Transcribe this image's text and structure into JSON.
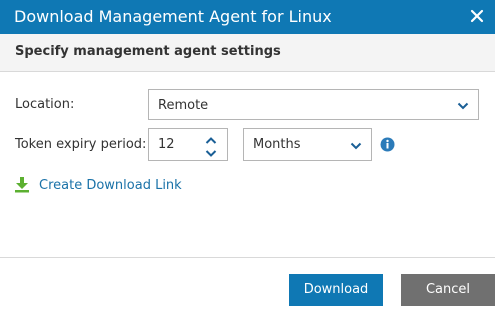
{
  "dialog": {
    "title": "Download Management Agent for Linux",
    "section_title": "Specify management agent settings",
    "close_icon": "close-icon"
  },
  "form": {
    "location": {
      "label": "Location:",
      "value": "Remote"
    },
    "token_expiry": {
      "label": "Token expiry period:",
      "amount": "12",
      "unit": "Months"
    },
    "info_icon": "info-icon"
  },
  "download_link": {
    "label": "Create Download Link",
    "icon": "download-icon"
  },
  "buttons": {
    "download": "Download",
    "cancel": "Cancel"
  },
  "colors": {
    "accent": "#0f78b4",
    "secondary_button": "#707070",
    "link": "#1a72a8",
    "download_icon": "#5cb031",
    "info_icon": "#2b7bb9"
  }
}
